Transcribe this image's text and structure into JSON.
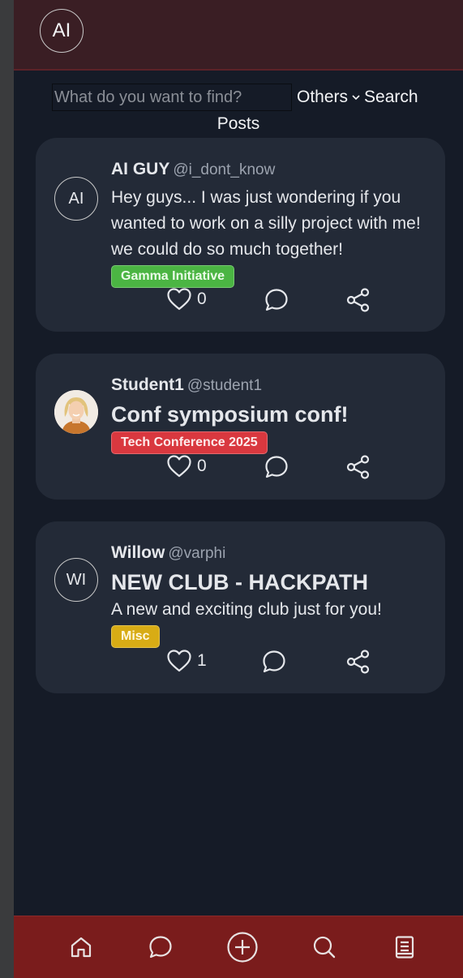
{
  "header": {
    "avatar_initials": "AI"
  },
  "search": {
    "placeholder": "What do you want to find?",
    "value": "",
    "filter_selected": "Others",
    "button_label": "Search"
  },
  "feed": {
    "heading": "Posts",
    "posts": [
      {
        "avatar_initials": "AI",
        "author": "AI GUY",
        "handle": "@i_dont_know",
        "body": "Hey guys... I was just wondering if you wanted to work on a silly project with me! we could do so much together!",
        "tag": "Gamma Initiative",
        "likes": "0"
      },
      {
        "author": "Student1",
        "handle": "@student1",
        "title": "Conf symposium conf!",
        "tag": "Tech Conference 2025",
        "likes": "0"
      },
      {
        "avatar_initials": "WI",
        "author": "Willow",
        "handle": "@varphi",
        "title": "NEW CLUB - HACKPATH",
        "body": "A new and exciting club just for you!",
        "tag": "Misc",
        "likes": "1"
      }
    ]
  },
  "bottom_nav": {
    "items": [
      "home-icon",
      "chat-icon",
      "add-post-icon",
      "search-icon",
      "notebook-icon"
    ]
  },
  "colors": {
    "topbar": "#3a1e24",
    "background": "#151b27",
    "card": "#232a37",
    "bottom_nav": "#7a1c1c",
    "tag_green": "#4bb543",
    "tag_red": "#d9383f",
    "tag_yellow": "#d8ac15"
  }
}
